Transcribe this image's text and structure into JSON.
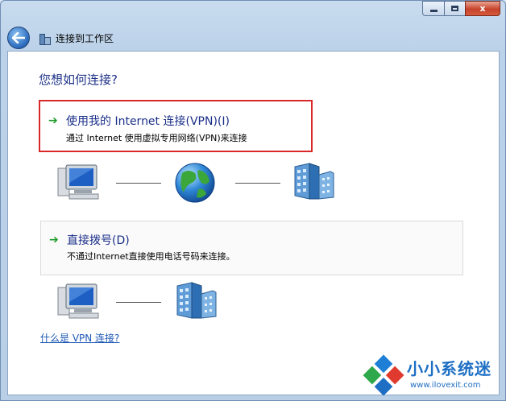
{
  "window": {
    "title": "连接到工作区",
    "caption_close": "x"
  },
  "main": {
    "question": "您想如何连接?",
    "options": [
      {
        "title": "使用我的 Internet 连接(VPN)(I)",
        "description": "通过 Internet 使用虚拟专用网络(VPN)来连接",
        "highlighted": true
      },
      {
        "title": "直接拨号(D)",
        "description": "不通过Internet直接使用电话号码来连接。",
        "highlighted": false
      }
    ],
    "help_link": "什么是 VPN 连接?"
  },
  "icons": {
    "back": "back-arrow-icon",
    "wizard": "network-buildings-icon",
    "option_arrow": "green-arrow-icon",
    "computer": "computer-icon",
    "globe": "globe-icon",
    "building": "office-building-icon"
  },
  "watermark": {
    "text": "小小系统迷",
    "url": "www.ilovexit.com"
  },
  "colors": {
    "title_blue": "#1e3287",
    "highlight_border": "#d92828",
    "link": "#1d58b5",
    "arrow_green": "#1f9b2a"
  }
}
